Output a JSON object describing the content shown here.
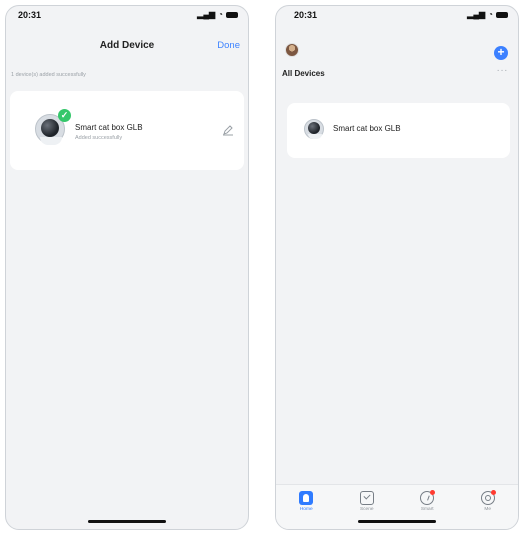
{
  "left_phone": {
    "status_time": "20:31",
    "title": "Add Device",
    "done_label": "Done",
    "success_summary": "1 device(s) added successfully",
    "device": {
      "name": "Smart cat box GLB",
      "status": "Added successfully"
    }
  },
  "right_phone": {
    "status_time": "20:31",
    "section_title": "All Devices",
    "more_label": "···",
    "device": {
      "name": "Smart cat box GLB"
    },
    "tabs": [
      {
        "label": "Home",
        "icon": "home-icon",
        "active": true
      },
      {
        "label": "Scene",
        "icon": "scene-icon",
        "active": false
      },
      {
        "label": "Smart",
        "icon": "smart-icon",
        "active": false
      },
      {
        "label": "Me",
        "icon": "me-icon",
        "active": false
      }
    ]
  },
  "colors": {
    "accent": "#3f84ff",
    "success": "#35c76b",
    "background": "#f2f3f5",
    "card": "#ffffff",
    "muted_text": "#9aa0a6"
  }
}
